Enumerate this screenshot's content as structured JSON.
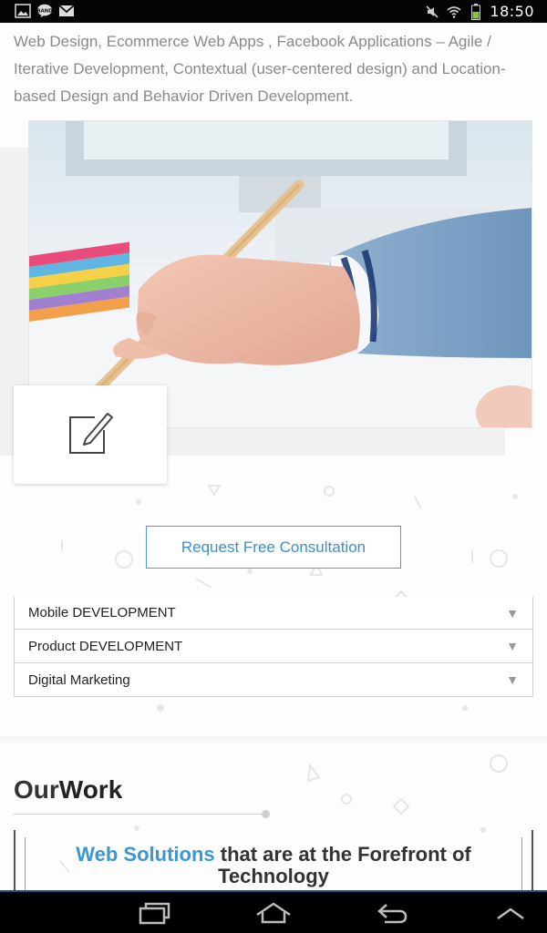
{
  "status_bar": {
    "time": "18:50",
    "left_icons": [
      "gallery-icon",
      "band-app-icon",
      "gmail-icon"
    ],
    "right_icons": [
      "mute-icon",
      "wifi-icon",
      "battery-icon"
    ]
  },
  "intro": {
    "text": "Web Design, Ecommerce Web Apps , Facebook Applications – Agile / Iterative Development, Contextual (user-centered design) and Location-based Design and Behavior Driven Development."
  },
  "feature_image": {
    "icon": "edit-icon"
  },
  "cta": {
    "label": "Request Free Consultation"
  },
  "accordion": {
    "items": [
      {
        "label": "Mobile DEVELOPMENT",
        "icon": "triangle-down-icon"
      },
      {
        "label": "Product DEVELOPMENT",
        "icon": "triangle-down-icon"
      },
      {
        "label": "Digital Marketing",
        "icon": "triangle-down-icon"
      }
    ]
  },
  "work": {
    "title_light": "Our",
    "title_bold": "Work",
    "headline_highlight": "Web Solutions",
    "headline_rest": " that are at the Forefront of Technology"
  },
  "colors": {
    "accent": "#3c96d6",
    "status_bar": "#050505",
    "nav_bar": "#000000"
  },
  "nav_bar": {
    "buttons": [
      "recent-apps-icon",
      "home-icon",
      "back-icon",
      "up-arrow-icon"
    ]
  }
}
